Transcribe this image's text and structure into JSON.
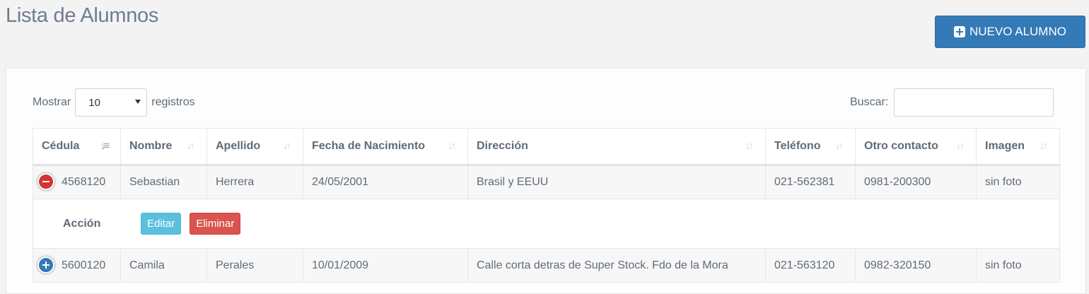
{
  "page_title": "Lista de Alumnos",
  "new_button_label": "NUEVO ALUMNO",
  "length": {
    "prefix": "Mostrar",
    "value": "10",
    "suffix": "registros"
  },
  "search": {
    "label": "Buscar:",
    "value": ""
  },
  "columns": [
    "Cédula",
    "Nombre",
    "Apellido",
    "Fecha de Nacimiento",
    "Dirección",
    "Teléfono",
    "Otro contacto",
    "Imagen"
  ],
  "rows": [
    {
      "cedula": "4568120",
      "nombre": "Sebastian",
      "apellido": "Herrera",
      "fecha": "24/05/2001",
      "direccion": "Brasil y EEUU",
      "telefono": "021-562381",
      "otro": "0981-200300",
      "imagen": "sin foto",
      "expanded": true
    },
    {
      "cedula": "5600120",
      "nombre": "Camila",
      "apellido": "Perales",
      "fecha": "10/01/2009",
      "direccion": "Calle corta detras de Super Stock. Fdo de la Mora",
      "telefono": "021-563120",
      "otro": "0982-320150",
      "imagen": "sin foto",
      "expanded": false
    }
  ],
  "child_row": {
    "label": "Acción",
    "edit_label": "Editar",
    "delete_label": "Eliminar"
  },
  "colors": {
    "primary": "#337ab7",
    "info": "#5bc0de",
    "danger": "#d9534f"
  }
}
